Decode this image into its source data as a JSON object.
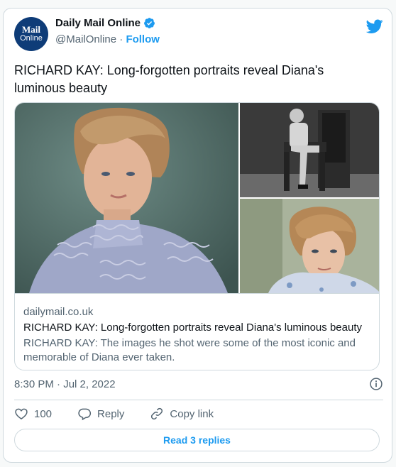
{
  "author": {
    "name": "Daily Mail Online",
    "handle": "@MailOnline",
    "follow_label": "Follow",
    "avatar_line1": "Mail",
    "avatar_line2": "Online",
    "verified": true
  },
  "tweet": {
    "text": "RICHARD KAY: Long-forgotten portraits reveal Diana's luminous beauty"
  },
  "link_card": {
    "domain": "dailymail.co.uk",
    "title": "RICHARD KAY: Long-forgotten portraits reveal Diana's luminous beauty",
    "description": "RICHARD KAY: The images he shot were some of the most iconic and memorable of Diana ever taken."
  },
  "meta": {
    "timestamp": "8:30 PM · Jul 2, 2022"
  },
  "actions": {
    "like_count": "100",
    "reply_label": "Reply",
    "copy_link_label": "Copy link"
  },
  "read_replies_label": "Read 3 replies",
  "colors": {
    "accent": "#1d9bf0",
    "border": "#cfd9de",
    "secondary_text": "#536471",
    "avatar_bg": "#0e3c78"
  },
  "icons": [
    "verified-badge-icon",
    "twitter-bird-icon",
    "info-icon",
    "heart-icon",
    "reply-icon",
    "copy-link-icon"
  ]
}
